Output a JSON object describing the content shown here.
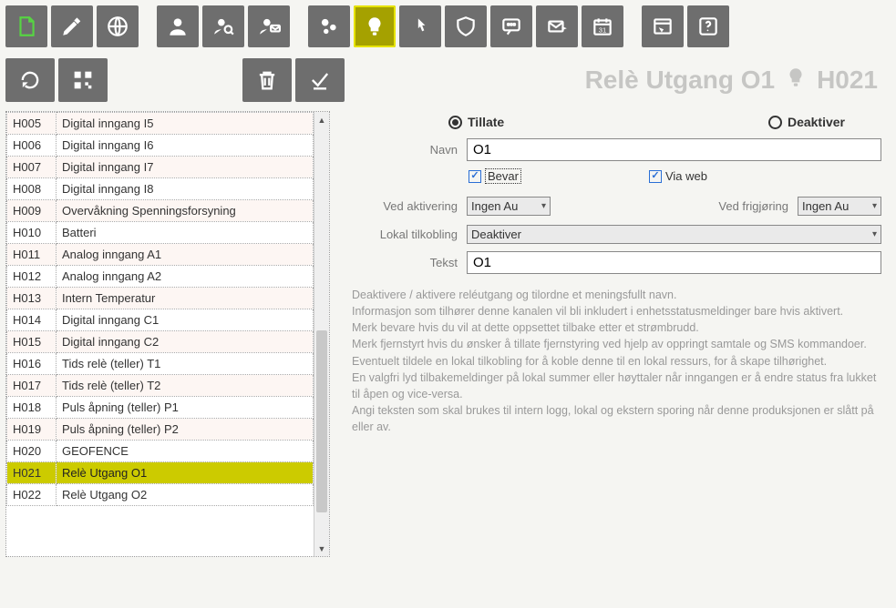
{
  "page_title_prefix": "Relè Utgang O1",
  "page_title_code": "H021",
  "list": [
    {
      "code": "H005",
      "label": "Digital inngang I5"
    },
    {
      "code": "H006",
      "label": "Digital inngang I6"
    },
    {
      "code": "H007",
      "label": "Digital inngang I7"
    },
    {
      "code": "H008",
      "label": "Digital inngang I8"
    },
    {
      "code": "H009",
      "label": "Overvåkning Spenningsforsyning"
    },
    {
      "code": "H010",
      "label": "Batteri"
    },
    {
      "code": "H011",
      "label": "Analog inngang A1"
    },
    {
      "code": "H012",
      "label": "Analog inngang A2"
    },
    {
      "code": "H013",
      "label": "Intern Temperatur"
    },
    {
      "code": "H014",
      "label": "Digital inngang C1"
    },
    {
      "code": "H015",
      "label": "Digital inngang C2"
    },
    {
      "code": "H016",
      "label": "Tids relè (teller) T1"
    },
    {
      "code": "H017",
      "label": "Tids relè (teller) T2"
    },
    {
      "code": "H018",
      "label": "Puls åpning (teller) P1"
    },
    {
      "code": "H019",
      "label": "Puls åpning (teller) P2"
    },
    {
      "code": "H020",
      "label": "GEOFENCE"
    },
    {
      "code": "H021",
      "label": "Relè Utgang O1",
      "selected": true
    },
    {
      "code": "H022",
      "label": "Relè Utgang O2"
    }
  ],
  "radio": {
    "allow": "Tillate",
    "disable": "Deaktiver"
  },
  "form": {
    "name_label": "Navn",
    "name_value": "O1",
    "preserve_label": "Bevar",
    "viaweb_label": "Via web",
    "on_activate_label": "Ved aktivering",
    "on_activate_value": "Ingen Au",
    "on_release_label": "Ved frigjøring",
    "on_release_value": "Ingen Au",
    "local_conn_label": "Lokal tilkobling",
    "local_conn_value": "Deaktiver",
    "text_label": "Tekst",
    "text_value": "O1"
  },
  "help": "Deaktivere / aktivere reléutgang og tilordne et meningsfullt navn.\nInformasjon som tilhører denne kanalen vil bli inkludert i enhetsstatusmeldinger bare hvis aktivert.\nMerk bevare hvis du vil at dette oppsettet tilbake etter et strømbrudd.\nMerk fjernstyrt hvis du ønsker å tillate fjernstyring ved hjelp av oppringt samtale og SMS kommandoer.\nEventuelt tildele en lokal tilkobling for å koble denne til en lokal ressurs, for å skape tilhørighet.\nEn valgfri lyd tilbakemeldinger  på lokal summer eller høyttaler når inngangen er å endre status fra lukket til åpen og vice-versa.\nAngi teksten som skal brukes til intern logg, lokal og ekstern sporing når denne produksjonen er slått på eller av."
}
